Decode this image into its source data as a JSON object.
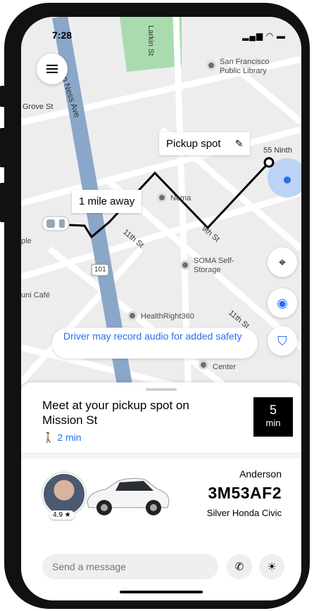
{
  "status_bar": {
    "time": "7:28",
    "icons": "▂▄▆ ◠ ▬"
  },
  "map": {
    "streets": [
      "Larkin St",
      "Van Ness Ave",
      "Grove St",
      "11th St",
      "9th St",
      "11th St",
      "101"
    ],
    "places": [
      {
        "name": "San Francisco Public Library"
      },
      {
        "name": "Pickup spot"
      },
      {
        "name": "55 Ninth"
      },
      {
        "name": "Nema"
      },
      {
        "name": "SOMA Self-Storage"
      },
      {
        "name": "HealthRight360"
      },
      {
        "name": "Center"
      },
      {
        "name": "ple"
      },
      {
        "name": "uni Café"
      }
    ],
    "distance_label": "1 mile away",
    "pickup_label": "Pickup spot",
    "safety_notice": "Driver may record audio for added safety",
    "route_color": "#000000",
    "accent_color": "#276ef1"
  },
  "trip": {
    "meet_text": "Meet at your pickup spot on Mission St",
    "walk_time": "🚶 2 min",
    "eta_value": "5",
    "eta_unit": "min"
  },
  "driver": {
    "name": "Anderson",
    "plate": "3M53AF2",
    "car": "Silver Honda Civic",
    "rating": "4.9 ★"
  },
  "actions": {
    "message_placeholder": "Send a message",
    "call_icon": "phone-icon",
    "more_icon": "sun-icon"
  }
}
